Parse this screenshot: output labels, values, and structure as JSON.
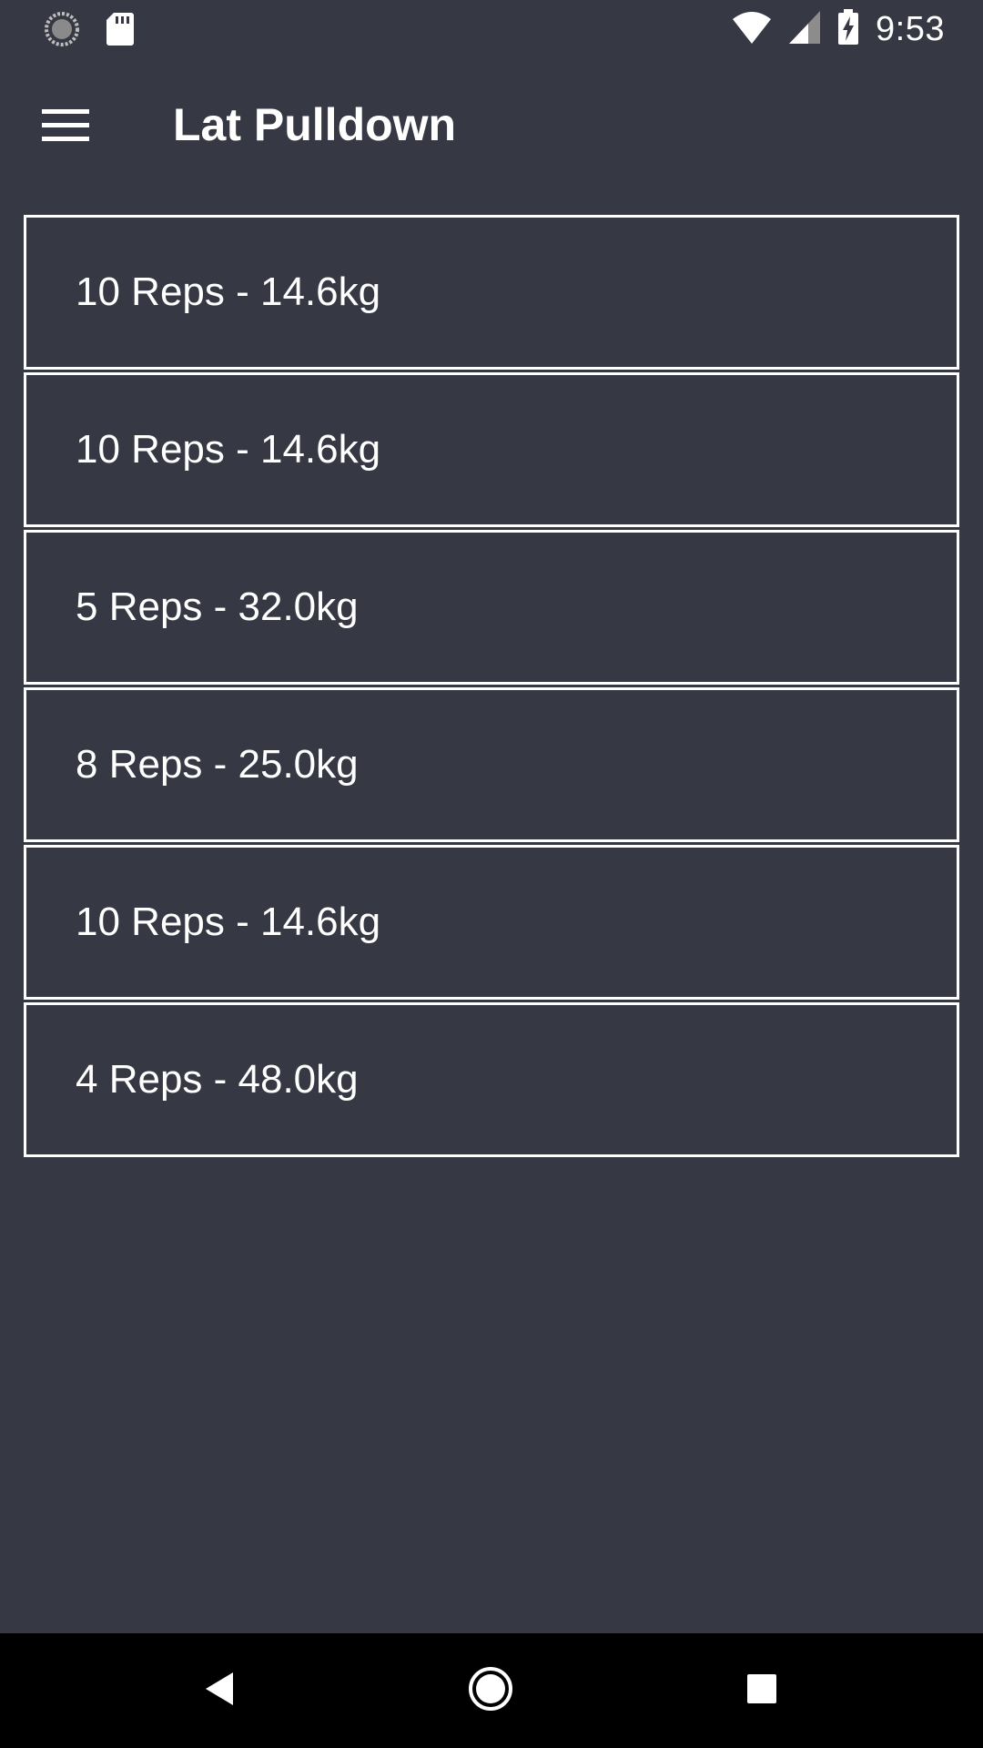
{
  "status_bar": {
    "time": "9:53",
    "left_icons": [
      "sync-icon",
      "sd-card-icon"
    ],
    "right_icons": [
      "wifi-icon",
      "cell-signal-icon",
      "battery-charging-icon"
    ]
  },
  "app_bar": {
    "title": "Lat Pulldown",
    "menu_icon": "hamburger-menu-icon"
  },
  "sets": [
    {
      "label": "10 Reps - 14.6kg"
    },
    {
      "label": "10 Reps - 14.6kg"
    },
    {
      "label": "5 Reps - 32.0kg"
    },
    {
      "label": "8 Reps - 25.0kg"
    },
    {
      "label": "10 Reps - 14.6kg"
    },
    {
      "label": "4 Reps - 48.0kg"
    }
  ],
  "nav_bar": {
    "icons": [
      "back-icon",
      "home-icon",
      "recents-icon"
    ]
  },
  "colors": {
    "background": "#363943",
    "border": "#ffffff",
    "text": "#ffffff",
    "nav_background": "#000000"
  }
}
